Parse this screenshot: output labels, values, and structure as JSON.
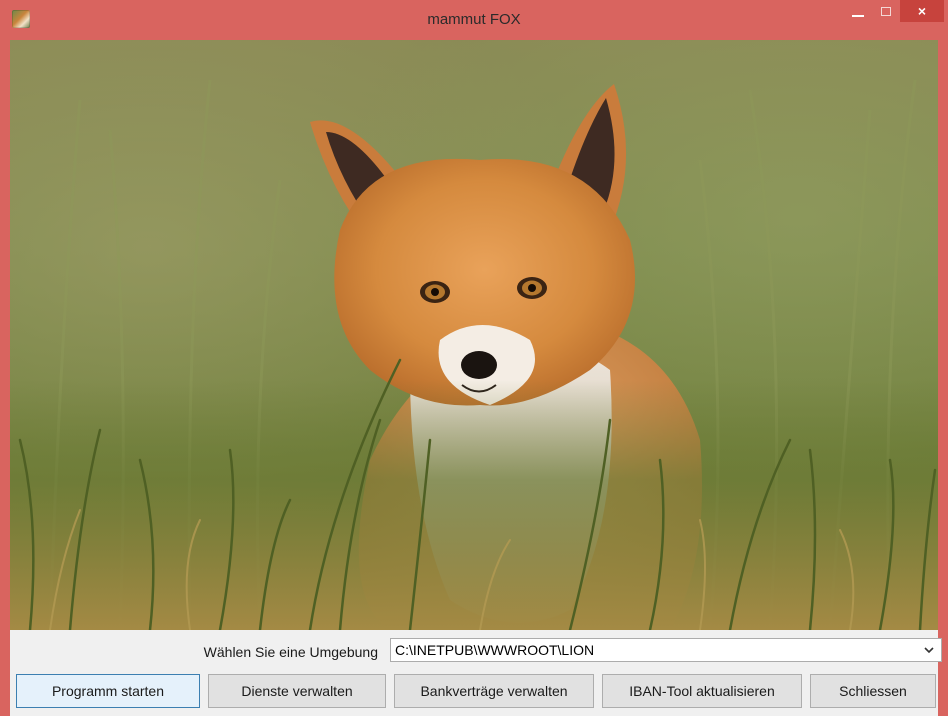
{
  "window": {
    "title": "mammut FOX",
    "controls": {
      "minimize_icon": "minimize-icon",
      "maximize_icon": "maximize-icon",
      "close_label": "×"
    },
    "colors": {
      "frame": "#d9645f",
      "close": "#c7433d"
    }
  },
  "image": {
    "subject": "fox-photo"
  },
  "environment": {
    "label": "Wählen Sie eine Umgebung",
    "selected": "C:\\INETPUB\\WWWROOT\\LION"
  },
  "buttons": {
    "start": "Programm starten",
    "services": "Dienste verwalten",
    "contracts": "Bankverträge verwalten",
    "iban": "IBAN-Tool aktualisieren",
    "close": "Schliessen"
  }
}
